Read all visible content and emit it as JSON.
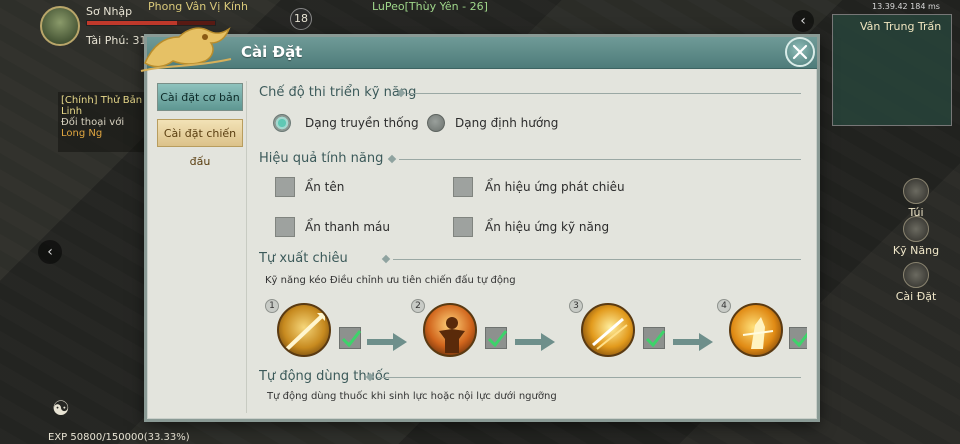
{
  "hud": {
    "player_name": "Sơ Nhập",
    "wealth": "Tài Phú: 31",
    "level": "18",
    "top_text_left": "Phong Vân Vị Kính",
    "top_text_right": "LuPeo[Thùy Yên - 26]",
    "quest_title": "[Chính] Thử Bản Linh",
    "quest_desc_prefix": "Đối thoại với ",
    "quest_desc_npc": "Long Ng",
    "exp": "EXP 50800/150000(33.33%)",
    "map_name": "Vân Trung Trấn",
    "clock": "13.39.42  184 ms",
    "side_buttons": [
      "Túi",
      "Kỹ Năng",
      "Cài Đặt"
    ],
    "hp_fraction": 0.7
  },
  "dialog": {
    "title": "Cài Đặt",
    "tabs": [
      {
        "label": "Cài đặt cơ bản",
        "active": true
      },
      {
        "label": "Cài đặt chiến đấu",
        "active": false
      }
    ],
    "sections": {
      "cast_mode": {
        "title": "Chế độ thi triển kỹ năng",
        "options": [
          {
            "label": "Dạng truyền thống",
            "selected": true
          },
          {
            "label": "Dạng định hướng",
            "selected": false
          }
        ]
      },
      "effects": {
        "title": "Hiệu quả tính năng",
        "options": [
          {
            "label": "Ẩn tên",
            "checked": false
          },
          {
            "label": "Ẩn hiệu ứng phát chiêu",
            "checked": false
          },
          {
            "label": "Ẩn thanh máu",
            "checked": false
          },
          {
            "label": "Ẩn hiệu ứng kỹ năng",
            "checked": false
          }
        ]
      },
      "auto_skill": {
        "title": "Tự xuất chiêu",
        "description": "Kỹ năng kéo Điều chỉnh ưu tiên chiến đấu tự động",
        "skills": [
          {
            "order": "1",
            "icon": "spear-strike-icon",
            "enabled": true
          },
          {
            "order": "2",
            "icon": "warrior-rage-icon",
            "enabled": true
          },
          {
            "order": "3",
            "icon": "blade-slash-icon",
            "enabled": true
          },
          {
            "order": "4",
            "icon": "flame-fist-icon",
            "enabled": true
          }
        ]
      },
      "auto_potion": {
        "title": "Tự động dùng thuốc",
        "description": "Tự động dùng thuốc khi sinh lực hoặc nội lực dưới ngưỡng"
      }
    }
  },
  "colors": {
    "header": "#5e8a88",
    "panel": "#e3e4dd",
    "active_tab": "#7fb3ae",
    "inactive_tab": "#e6cf99",
    "check": "#3dd36a"
  }
}
